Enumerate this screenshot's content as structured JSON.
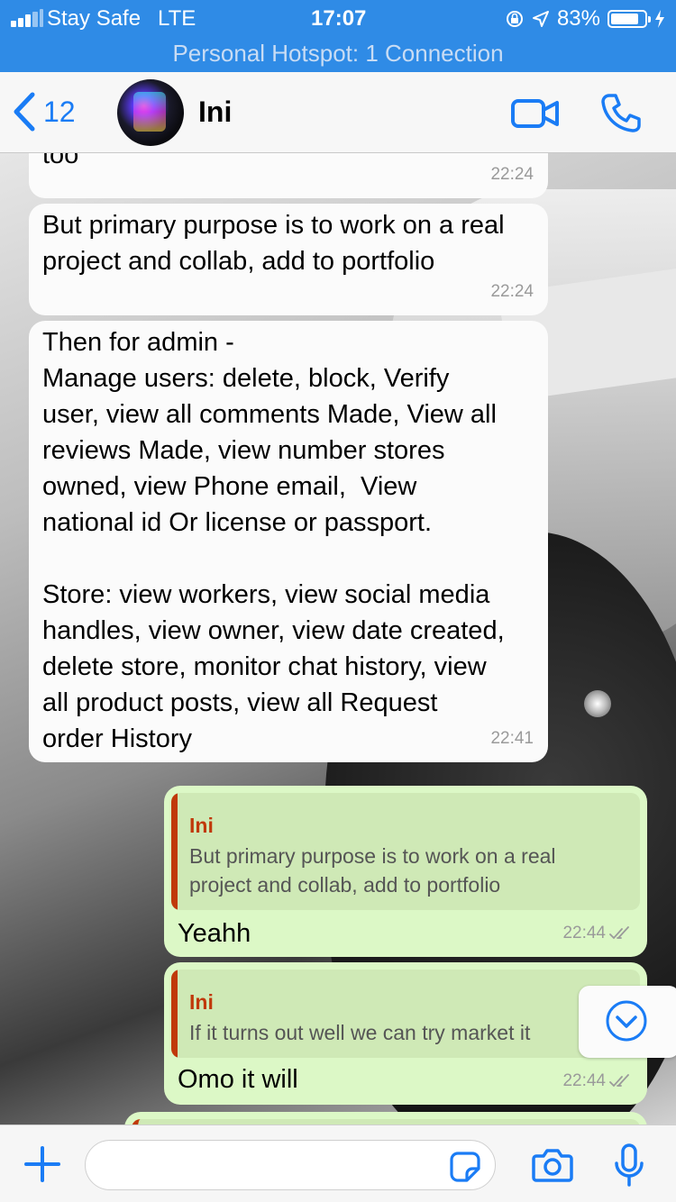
{
  "status_bar": {
    "carrier": "Stay Safe",
    "network": "LTE",
    "time": "17:07",
    "battery": "83%",
    "battery_level": 0.83,
    "hotspot": "Personal Hotspot: 1 Connection"
  },
  "nav": {
    "back_count": "12",
    "contact_name": "Ini"
  },
  "messages": [
    {
      "direction": "incoming",
      "text": "too",
      "time": "22:24"
    },
    {
      "direction": "incoming",
      "text": "But primary purpose is to work on a real\nproject and collab, add to portfolio",
      "time": "22:24"
    },
    {
      "direction": "incoming",
      "text": "Then for admin -\nManage users: delete, block, Verify\nuser, view all comments Made, View all\nreviews Made, view number stores\nowned, view Phone email,  View\nnational id Or license or passport.\n\nStore: view workers, view social media\nhandles, view owner, view date created,\ndelete store, monitor chat history, view\nall product posts, view all Request\norder History",
      "time": "22:41"
    },
    {
      "direction": "outgoing",
      "quote_author": "Ini",
      "quote_text": "But primary purpose is to work on a real\nproject and collab, add to portfolio",
      "text": "Yeahh",
      "time": "22:44"
    },
    {
      "direction": "outgoing",
      "quote_author": "Ini",
      "quote_text": "If it turns out well we can try market it",
      "text": "Omo it will",
      "time": "22:44"
    }
  ],
  "input": {
    "placeholder": "",
    "value": ""
  },
  "colors": {
    "status_bar": "#2f8be6",
    "accent": "#1a7cf5",
    "outgoing_bubble": "#dcf8c6",
    "quote_author": "#c0390a"
  }
}
